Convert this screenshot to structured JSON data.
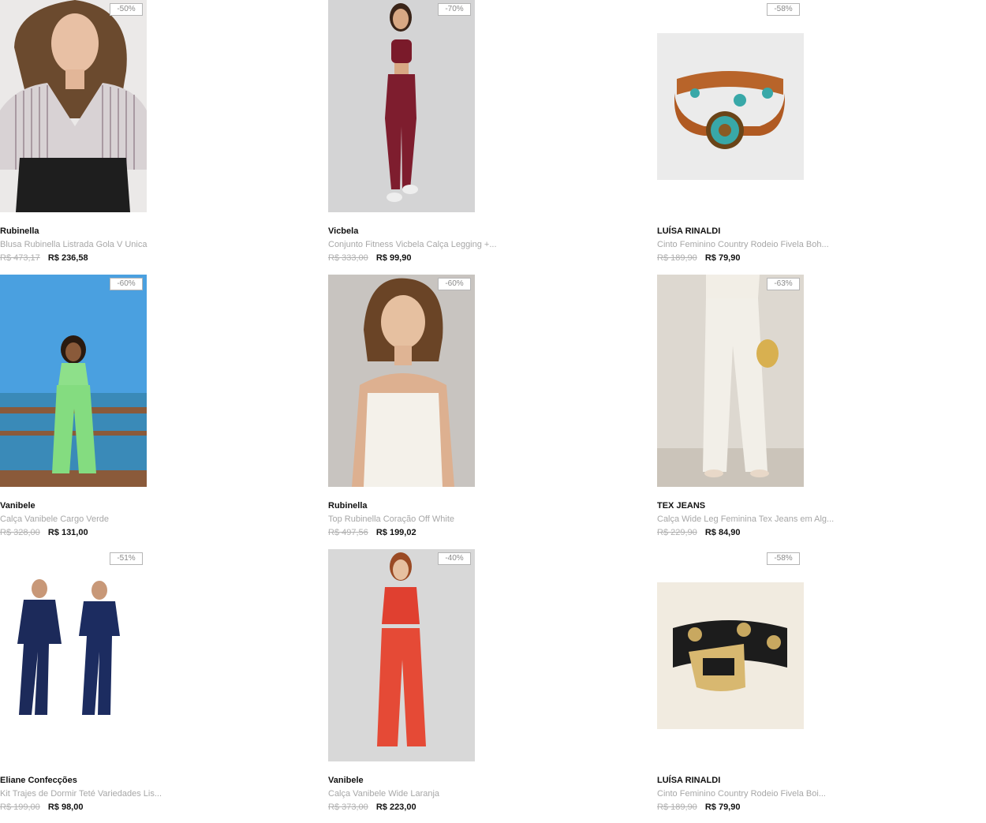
{
  "products": [
    {
      "brand": "Rubinella",
      "title": "Blusa Rubinella Listrada Gola V Unica",
      "old_price": "R$ 473,17",
      "price": "R$ 236,58",
      "discount": "-50%",
      "image": "striped-blouse-photo"
    },
    {
      "brand": "Vicbela",
      "title": "Conjunto Fitness Vicbela Calça Legging +...",
      "old_price": "R$ 333,00",
      "price": "R$ 99,90",
      "discount": "-70%",
      "image": "fitness-set-photo"
    },
    {
      "brand": "LUÍSA RINALDI",
      "title": "Cinto Feminino Country Rodeio Fivela Boh...",
      "old_price": "R$ 189,90",
      "price": "R$ 79,90",
      "discount": "-58%",
      "image": "brown-belt-photo"
    },
    {
      "brand": "Vanibele",
      "title": "Calça Vanibele Cargo Verde",
      "old_price": "R$ 328,00",
      "price": "R$ 131,00",
      "discount": "-60%",
      "image": "green-cargo-photo"
    },
    {
      "brand": "Rubinella",
      "title": "Top Rubinella Coração Off White",
      "old_price": "R$ 497,56",
      "price": "R$ 199,02",
      "discount": "-60%",
      "image": "white-top-photo"
    },
    {
      "brand": "TEX JEANS",
      "title": "Calça Wide Leg Feminina Tex Jeans em Alg...",
      "old_price": "R$ 229,90",
      "price": "R$ 84,90",
      "discount": "-63%",
      "image": "white-jeans-photo"
    },
    {
      "brand": "Eliane Confecções",
      "title": "Kit Trajes de Dormir Teté Variedades Lis...",
      "old_price": "R$ 199,00",
      "price": "R$ 98,00",
      "discount": "-51%",
      "image": "navy-pajamas-photo"
    },
    {
      "brand": "Vanibele",
      "title": "Calça Vanibele Wide Laranja",
      "old_price": "R$ 373,00",
      "price": "R$ 223,00",
      "discount": "-40%",
      "image": "orange-pants-photo"
    },
    {
      "brand": "LUÍSA RINALDI",
      "title": "Cinto Feminino Country Rodeio Fivela Boi...",
      "old_price": "R$ 189,90",
      "price": "R$ 79,90",
      "discount": "-58%",
      "image": "black-belt-photo"
    }
  ]
}
